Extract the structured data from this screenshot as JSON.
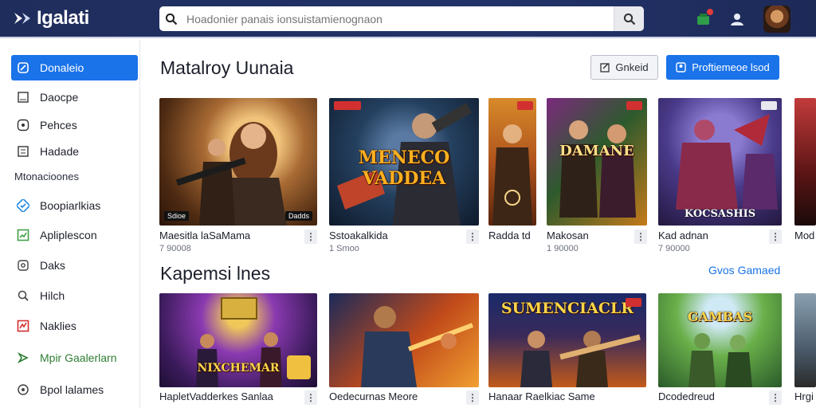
{
  "brand": {
    "name": "Igalati"
  },
  "search": {
    "value": "",
    "placeholder": "Hoadonier panais ionsuistamienognaon"
  },
  "sidebar": {
    "items": [
      {
        "label": "Donaleio",
        "icon": "link-icon"
      },
      {
        "label": "Daocpe",
        "icon": "document-icon"
      },
      {
        "label": "Pehces",
        "icon": "gamepad-icon"
      },
      {
        "label": "Hadade",
        "icon": "list-icon"
      }
    ],
    "section_label": "Mtonacioones",
    "section_items": [
      {
        "label": "Boopiarlkias",
        "icon": "check-icon",
        "color": "#1e88e5"
      },
      {
        "label": "Apliplescon",
        "icon": "trend-icon",
        "color": "#43a047"
      },
      {
        "label": "Daks",
        "icon": "gear-icon",
        "color": "#444444"
      },
      {
        "label": "Hilch",
        "icon": "search-icon",
        "color": "#444444"
      },
      {
        "label": "Naklies",
        "icon": "chart-icon",
        "color": "#d32f2f"
      },
      {
        "label": "Mpir Gaalerlarn",
        "icon": "arrow-icon",
        "color": "#2e7d32"
      },
      {
        "label": "Bpol lalames",
        "icon": "circle-icon",
        "color": "#444444"
      }
    ]
  },
  "main": {
    "section1_title": "Matalroy Uunaia",
    "btn_outline": "Gnkeid",
    "btn_primary": "Proftiemeoe lsod",
    "section2_title": "Kapemsi lnes",
    "see_more": "Gvos Gamaed",
    "row1": [
      {
        "title": "Maesitla laSaMama",
        "sub": "7 90008",
        "badge_left": "Sdioe",
        "badge_right": "Dadds"
      },
      {
        "title": "Sstoakalkida",
        "sub": "1 Smoo",
        "thumb_text": "MENECO VADDEA"
      },
      {
        "title": "Radda td",
        "sub": ""
      },
      {
        "title": "Makosan",
        "sub": "1 90000",
        "thumb_text": "DAMANE"
      },
      {
        "title": "Kad adnan",
        "sub": "7 90000",
        "thumb_text": "KOCSASHIS"
      },
      {
        "title": "Mod",
        "sub": ""
      }
    ],
    "row2": [
      {
        "title": "HapletVadderkes Sanlaa",
        "thumb_text": "NIXCHEMAR"
      },
      {
        "title": "Oedecurnas Meore",
        "thumb_text": ""
      },
      {
        "title": "Hanaar Raelkiac Same",
        "thumb_text": "SUMENCIACLR"
      },
      {
        "title": "Dcodedreud",
        "thumb_text": "GAMBAS"
      },
      {
        "title": "Hrgi",
        "thumb_text": ""
      }
    ]
  },
  "colors": {
    "topbar": "#23336a",
    "accent": "#1a73e8"
  }
}
